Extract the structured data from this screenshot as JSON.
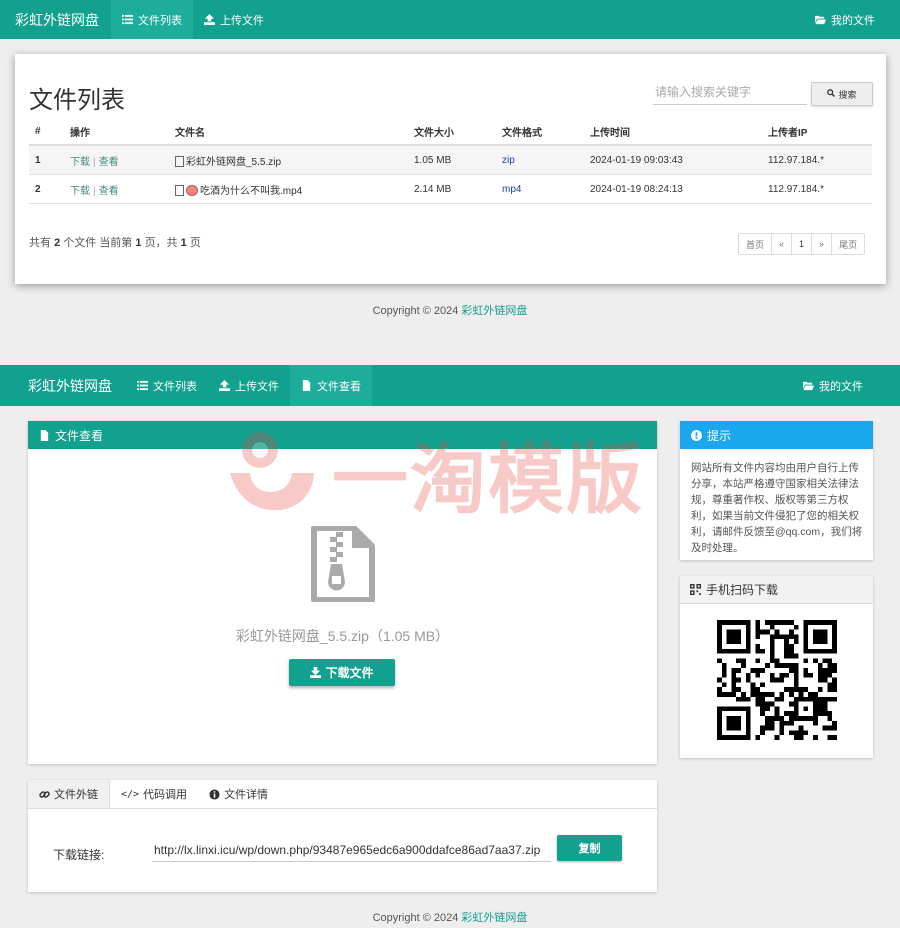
{
  "top": {
    "navbar": {
      "brand": "彩虹外链网盘",
      "items": [
        {
          "label": "文件列表",
          "icon": "list-icon",
          "active": true
        },
        {
          "label": "上传文件",
          "icon": "upload-icon",
          "active": false
        }
      ],
      "my_files": "我的文件"
    },
    "card": {
      "title": "文件列表",
      "search_placeholder": "请输入搜索关键字",
      "search_button": "搜索",
      "columns": [
        "#",
        "操作",
        "文件名",
        "文件大小",
        "文件格式",
        "上传时间",
        "上传者IP"
      ],
      "rows": [
        {
          "num": "1",
          "download": "下载",
          "sep": "|",
          "view": "查看",
          "file_icon": "zip-file-icon",
          "name": "彩虹外链网盘_5.5.zip",
          "size": "1.05 MB",
          "format": "zip",
          "time": "2024-01-19 09:03:43",
          "ip": "112.97.184.*"
        },
        {
          "num": "2",
          "download": "下载",
          "sep": "|",
          "view": "查看",
          "file_icon": "video-file-icon",
          "name": "吃酒为什么不叫我.mp4",
          "size": "2.14 MB",
          "format": "mp4",
          "time": "2024-01-19 08:24:13",
          "ip": "112.97.184.*"
        }
      ],
      "summary": {
        "prefix": "共有",
        "count": "2",
        "mid": "个文件  当前第",
        "page": "1",
        "mid2": "页，共",
        "total": "1",
        "suffix": "页"
      },
      "pagination": [
        "首页",
        "«",
        "1",
        "»",
        "尾页"
      ]
    },
    "footer": {
      "text": "Copyright © 2024",
      "link": "彩虹外链网盘"
    }
  },
  "bottom": {
    "navbar": {
      "brand": "彩虹外链网盘",
      "items": [
        {
          "label": "文件列表",
          "icon": "list-icon",
          "active": false
        },
        {
          "label": "上传文件",
          "icon": "upload-icon",
          "active": false
        },
        {
          "label": "文件查看",
          "icon": "file-icon",
          "active": true
        }
      ],
      "my_files": "我的文件"
    },
    "watermark": "一淘模版",
    "view_panel": {
      "title": "文件查看",
      "file_label": "彩虹外链网盘_5.5.zip（1.05 MB）",
      "download_button": "下载文件"
    },
    "tip_panel": {
      "title": "提示",
      "text": "网站所有文件内容均由用户自行上传分享，本站严格遵守国家相关法律法规，尊重著作权、版权等第三方权利，如果当前文件侵犯了您的相关权利，请邮件反馈至@qq.com，我们将及时处理。"
    },
    "qr_panel": {
      "title": "手机扫码下载"
    },
    "link_panel": {
      "tabs": [
        {
          "label": "文件外链",
          "icon": "link-icon"
        },
        {
          "label": "代码调用",
          "icon": "code-icon"
        },
        {
          "label": "文件详情",
          "icon": "info-icon"
        }
      ],
      "download_label": "下载链接:",
      "url": "http://lx.linxi.icu/wp/down.php/93487e965edc6a900ddafce86ad7aa37.zip",
      "copy_button": "复制"
    },
    "footer": {
      "text": "Copyright © 2024",
      "link": "彩虹外链网盘"
    }
  },
  "colors": {
    "primary": "#12a08f",
    "info": "#1aa7ed",
    "format_link": "#1d3fa8"
  }
}
